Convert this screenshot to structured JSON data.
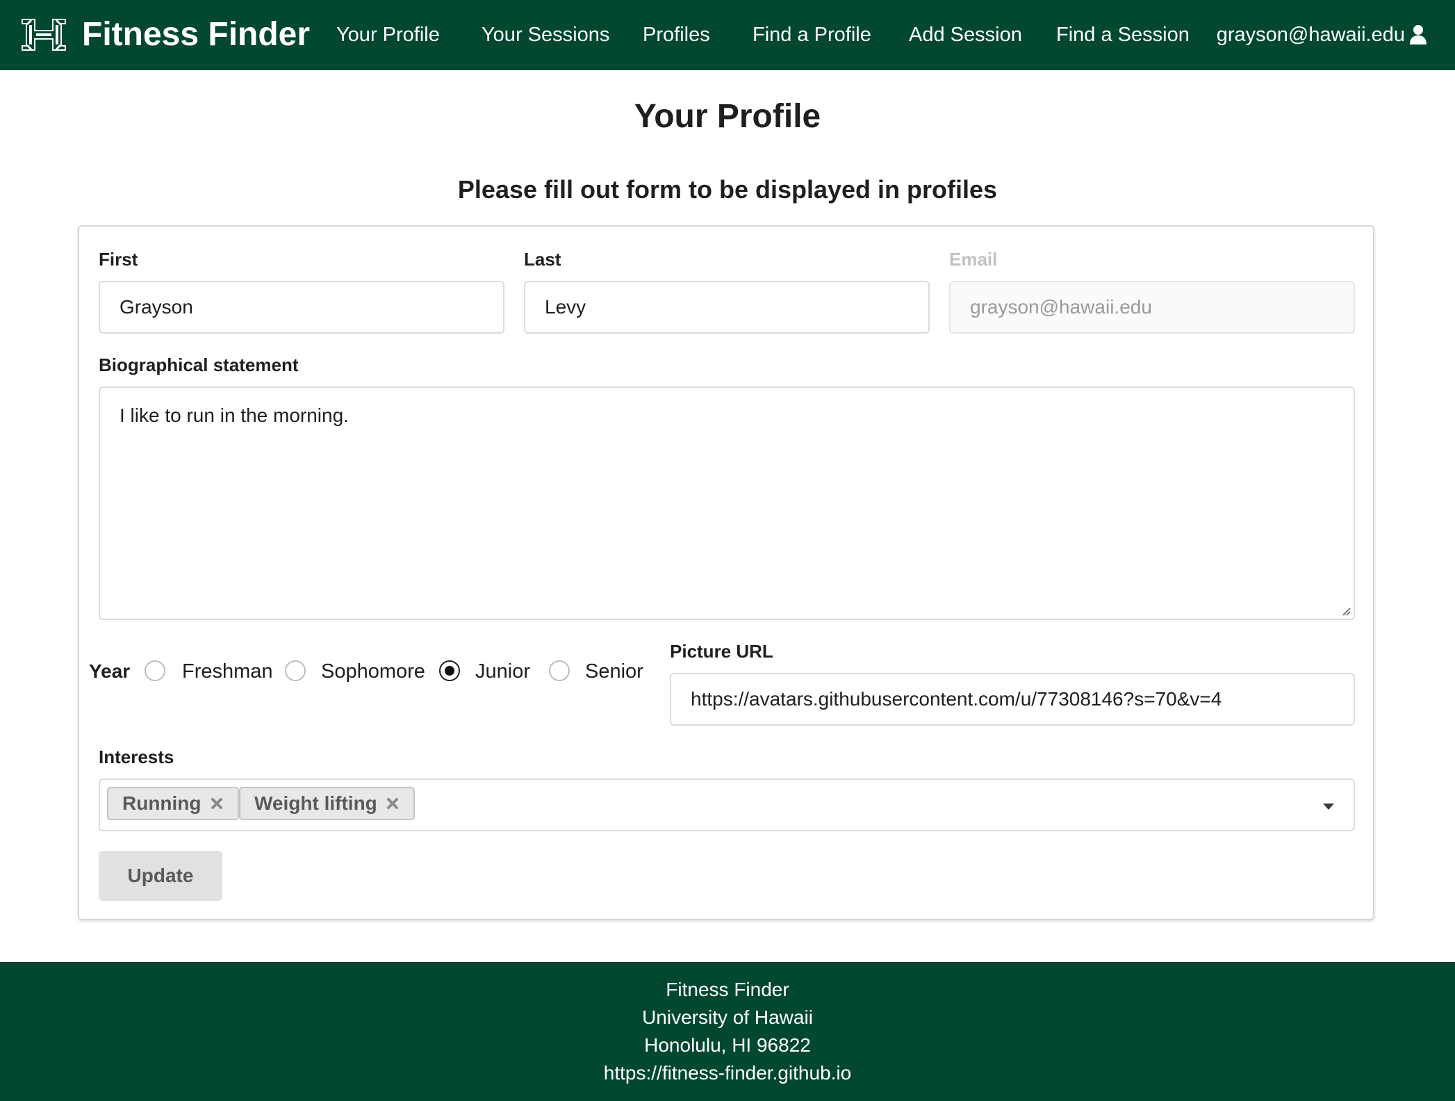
{
  "navbar": {
    "brand_title": "Fitness Finder",
    "logo_icon": "hawaii-h-logo",
    "items": [
      {
        "label": "Your Profile"
      },
      {
        "label": "Your Sessions"
      },
      {
        "label": "Profiles"
      },
      {
        "label": "Find a Profile"
      },
      {
        "label": "Add Session"
      },
      {
        "label": "Find a Session"
      }
    ],
    "user_email": "grayson@hawaii.edu",
    "user_icon": "user-icon",
    "background_color": "#024731"
  },
  "page": {
    "title": "Your Profile",
    "subtitle": "Please fill out form to be displayed in profiles"
  },
  "form": {
    "first": {
      "label": "First",
      "value": "Grayson"
    },
    "last": {
      "label": "Last",
      "value": "Levy"
    },
    "email": {
      "label": "Email",
      "value": "grayson@hawaii.edu",
      "disabled": true
    },
    "bio": {
      "label": "Biographical statement",
      "value": "I like to run in the morning."
    },
    "year": {
      "label": "Year",
      "options": [
        "Freshman",
        "Sophomore",
        "Junior",
        "Senior"
      ],
      "selected": "Junior"
    },
    "picture": {
      "label": "Picture URL",
      "value": "https://avatars.githubusercontent.com/u/77308146?s=70&v=4"
    },
    "interests": {
      "label": "Interests",
      "selected": [
        "Running",
        "Weight lifting"
      ],
      "remove_icon": "close-icon",
      "dropdown_icon": "caret-down-icon"
    },
    "submit_label": "Update"
  },
  "footer": {
    "lines": [
      "Fitness Finder",
      "University of Hawaii",
      "Honolulu, HI 96822",
      "https://fitness-finder.github.io"
    ]
  }
}
